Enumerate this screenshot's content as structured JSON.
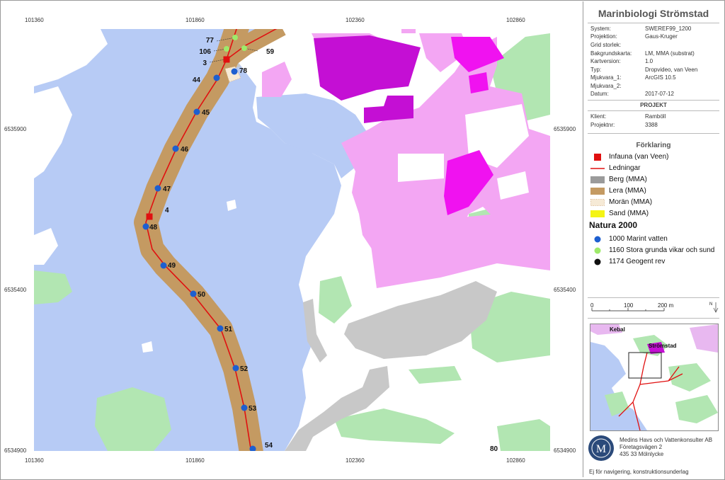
{
  "map": {
    "x_ticks": [
      "101360",
      "101860",
      "102360",
      "102860"
    ],
    "y_ticks": [
      "6535900",
      "6535400",
      "6534900"
    ],
    "points": [
      {
        "label": "77",
        "kind": "1160"
      },
      {
        "label": "106",
        "kind": "1160"
      },
      {
        "label": "59",
        "kind": "1160"
      },
      {
        "label": "3",
        "kind": "infauna"
      },
      {
        "label": "78",
        "kind": "1000"
      },
      {
        "label": "44",
        "kind": "1000"
      },
      {
        "label": "45",
        "kind": "1000"
      },
      {
        "label": "46",
        "kind": "1000"
      },
      {
        "label": "47",
        "kind": "1000"
      },
      {
        "label": "4",
        "kind": "infauna"
      },
      {
        "label": "48",
        "kind": "1000"
      },
      {
        "label": "49",
        "kind": "1000"
      },
      {
        "label": "50",
        "kind": "1000"
      },
      {
        "label": "51",
        "kind": "1000"
      },
      {
        "label": "52",
        "kind": "1000"
      },
      {
        "label": "53",
        "kind": "1000"
      },
      {
        "label": "54",
        "kind": "1000"
      },
      {
        "label": "80",
        "kind": "1000"
      }
    ],
    "colors": {
      "water": "#b7cbf5",
      "land": "#ffffff",
      "urban": "#f3a6f3",
      "dense": "#c40fd4",
      "magenta": "#f012f0",
      "green": "#b2e6b2",
      "rock": "#c8c8c8",
      "corridor": "#c49a62",
      "line": "#e01010",
      "blue_point": "#1d5fd0",
      "green_point": "#9eea6a",
      "infauna": "#e01010"
    }
  },
  "sidebar": {
    "title": "Marinbiologi Strömstad",
    "meta": [
      {
        "key": "System:",
        "value": "SWEREF99_1200"
      },
      {
        "key": "Projektion:",
        "value": "Gaus-Kruger"
      },
      {
        "key": "Grid storlek:",
        "value": ""
      },
      {
        "key": "Bakgrundskarta:",
        "value": "LM, MMA (substrat)"
      },
      {
        "key": "Kartversion:",
        "value": "1.0"
      },
      {
        "key": "Typ:",
        "value": "Dropvideo, van Veen"
      },
      {
        "key": "Mjukvara_1:",
        "value": "ArcGIS 10.5"
      },
      {
        "key": "Mjukvara_2:",
        "value": ""
      },
      {
        "key": "Datum:",
        "value": "2017-07-12"
      }
    ],
    "project_header": "PROJEKT",
    "project": [
      {
        "key": "Klient:",
        "value": "Ramböll"
      },
      {
        "key": "Projektnr:",
        "value": "3388"
      }
    ],
    "legend_title": "Förklaring",
    "legend": [
      {
        "label": "Infauna (van Veen)",
        "symbol": "red-square"
      },
      {
        "label": "Ledningar",
        "symbol": "red-line"
      },
      {
        "label": "Berg (MMA)",
        "symbol": "grey-box"
      },
      {
        "label": "Lera (MMA)",
        "symbol": "brown-box"
      },
      {
        "label": "Morän (MMA)",
        "symbol": "dotted-box"
      },
      {
        "label": "Sand (MMA)",
        "symbol": "yellow-box"
      }
    ],
    "natura_title": "Natura 2000",
    "natura": [
      {
        "label": "1000 Marint vatten",
        "color": "#1d5fd0"
      },
      {
        "label": "1160 Stora grunda vikar och sund",
        "color": "#9eea6a"
      },
      {
        "label": "1174 Geogent rev",
        "color": "#111111"
      }
    ],
    "scale": {
      "labels": [
        "0",
        "100",
        "200 m"
      ]
    },
    "north": "N",
    "inset": {
      "labels": [
        "Kebal",
        "Strömstad"
      ]
    },
    "company": [
      "Medins Havs och Vattenkonsulter AB",
      "Företagsvägen 2",
      "435 33 Mölnlycke"
    ],
    "disclaimer": "Ej för navigering, konstruktionsunderlag"
  }
}
